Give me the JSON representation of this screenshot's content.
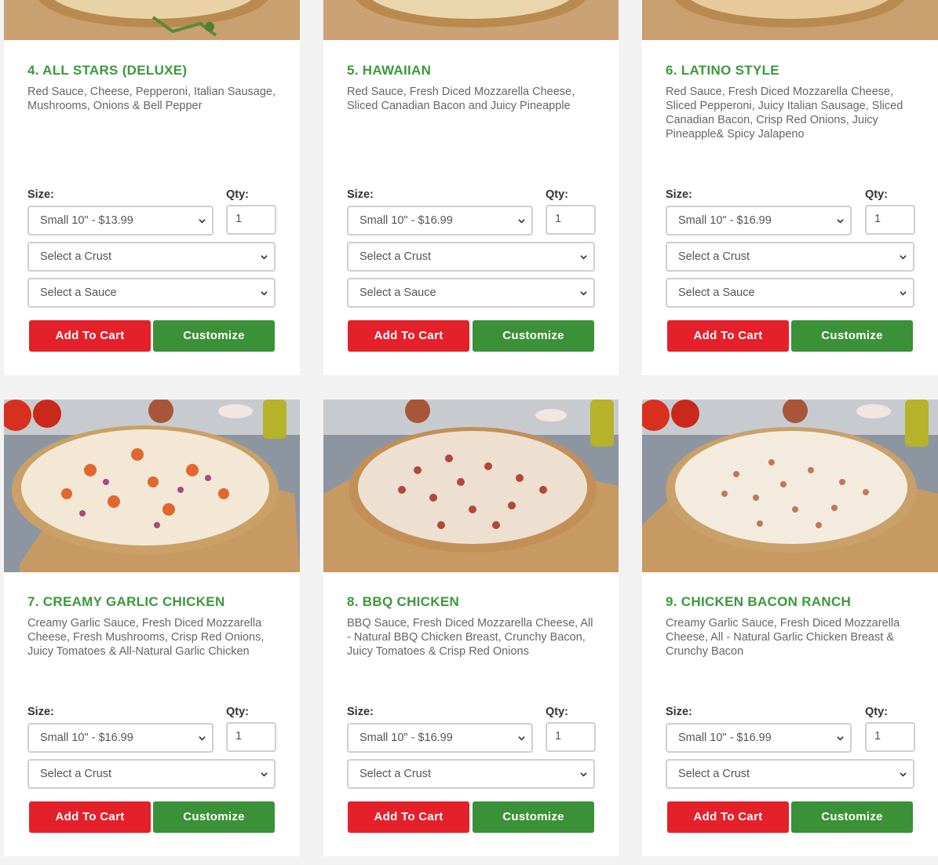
{
  "labels": {
    "size": "Size:",
    "qty": "Qty:"
  },
  "colors": {
    "title_green": "#3a9a3a",
    "cart_red": "#e4202a",
    "customize_green": "#3b9137"
  },
  "cards": [
    {
      "title": "4. ALL STARS (DELUXE)",
      "description": "Red Sauce, Cheese, Pepperoni, Italian Sausage, Mushrooms, Onions & Bell Pepper",
      "size_value": "Small 10\" - $13.99",
      "qty_value": "1",
      "crust_value": "Select a Crust",
      "sauce_value": "Select a Sauce",
      "add_label": "Add To Cart",
      "customize_label": "Customize"
    },
    {
      "title": "5. HAWAIIAN",
      "description": "Red Sauce, Fresh Diced Mozzarella Cheese, Sliced Canadian Bacon and Juicy Pineapple",
      "size_value": "Small 10\" - $16.99",
      "qty_value": "1",
      "crust_value": "Select a Crust",
      "sauce_value": "Select a Sauce",
      "add_label": "Add To Cart",
      "customize_label": "Customize"
    },
    {
      "title": "6. LATINO STYLE",
      "description": "Red Sauce, Fresh Diced Mozzarella Cheese, Sliced Pepperoni, Juicy Italian Sausage, Sliced Canadian Bacon, Crisp Red Onions, Juicy Pineapple& Spicy Jalapeno",
      "size_value": "Small 10\" - $16.99",
      "qty_value": "1",
      "crust_value": "Select a Crust",
      "sauce_value": "Select a Sauce",
      "add_label": "Add To Cart",
      "customize_label": "Customize"
    },
    {
      "title": "7. CREAMY GARLIC CHICKEN",
      "description": "Creamy Garlic Sauce, Fresh Diced Mozzarella Cheese, Fresh Mushrooms, Crisp Red Onions, Juicy Tomatoes & All-Natural Garlic Chicken",
      "size_value": "Small 10\" - $16.99",
      "qty_value": "1",
      "crust_value": "Select a Crust",
      "add_label": "Add To Cart",
      "customize_label": "Customize"
    },
    {
      "title": "8. BBQ CHICKEN",
      "description": "BBQ Sauce, Fresh Diced Mozzarella Cheese, All - Natural BBQ Chicken Breast, Crunchy Bacon, Juicy Tomatoes & Crisp Red Onions",
      "size_value": "Small 10\" - $16.99",
      "qty_value": "1",
      "crust_value": "Select a Crust",
      "add_label": "Add To Cart",
      "customize_label": "Customize"
    },
    {
      "title": "9. CHICKEN BACON RANCH",
      "description": "Creamy Garlic Sauce, Fresh Diced Mozzarella Cheese, All - Natural Garlic Chicken Breast & Crunchy Bacon",
      "size_value": "Small 10\" - $16.99",
      "qty_value": "1",
      "crust_value": "Select a Crust",
      "add_label": "Add To Cart",
      "customize_label": "Customize"
    }
  ]
}
